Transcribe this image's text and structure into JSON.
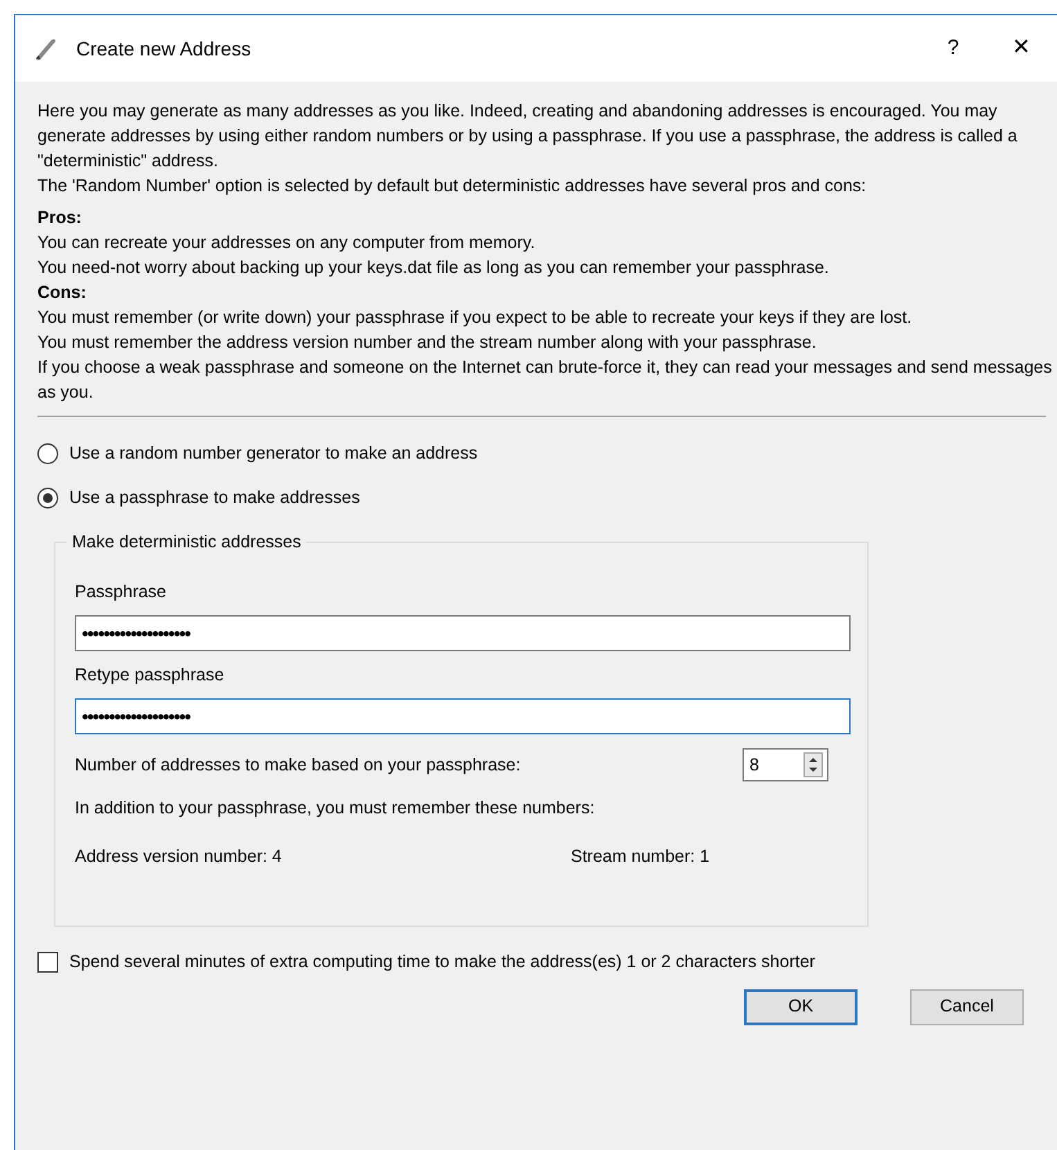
{
  "window": {
    "title": "Create new Address",
    "help_button": "?",
    "close_button": "✕"
  },
  "description": [
    {
      "kind": "text",
      "text": "Here you may generate as many addresses as you like. Indeed, creating and abandoning addresses is encouraged. You may generate addresses by using either random numbers or by using a passphrase. If you use a passphrase, the address is called a \"deterministic\" address."
    },
    {
      "kind": "text",
      "text": "The 'Random Number' option is selected by default but deterministic addresses have several pros and cons:"
    },
    {
      "kind": "heading",
      "text": "Pros:"
    },
    {
      "kind": "text",
      "text": "You can recreate your addresses on any computer from memory."
    },
    {
      "kind": "text",
      "text": "You need-not worry about backing up your keys.dat file as long as you can remember your passphrase."
    },
    {
      "kind": "heading",
      "text": "Cons:"
    },
    {
      "kind": "text",
      "text": "You must remember (or write down) your passphrase if you expect to be able to recreate your keys if they are lost."
    },
    {
      "kind": "text",
      "text": "You must remember the address version number and the stream number along with your passphrase."
    },
    {
      "kind": "text",
      "text": "If you choose a weak passphrase and someone on the Internet can brute-force it, they can read your messages and send messages as you."
    }
  ],
  "options": [
    {
      "label": "Use a random number generator to make an address",
      "selected": false
    },
    {
      "label": "Use a passphrase to make addresses",
      "selected": true
    }
  ],
  "group": {
    "title": "Make deterministic addresses",
    "fields": [
      {
        "label": "Passphrase",
        "value": "••••••••••••••••••••",
        "focused": false
      },
      {
        "label": "Retype passphrase",
        "value": "••••••••••••••••••••",
        "focused": true
      }
    ],
    "count_label": "Number of addresses to make based on your passphrase:",
    "count_value": "8",
    "note": "In addition to your passphrase, you must remember these numbers:",
    "version": "Address version number: 4",
    "stream": "Stream number: 1"
  },
  "shorter": {
    "label": "Spend several minutes of extra computing time to make the address(es) 1 or 2 characters shorter",
    "checked": false
  },
  "buttons": [
    {
      "label": "OK",
      "default": true
    },
    {
      "label": "Cancel",
      "default": false
    }
  ]
}
